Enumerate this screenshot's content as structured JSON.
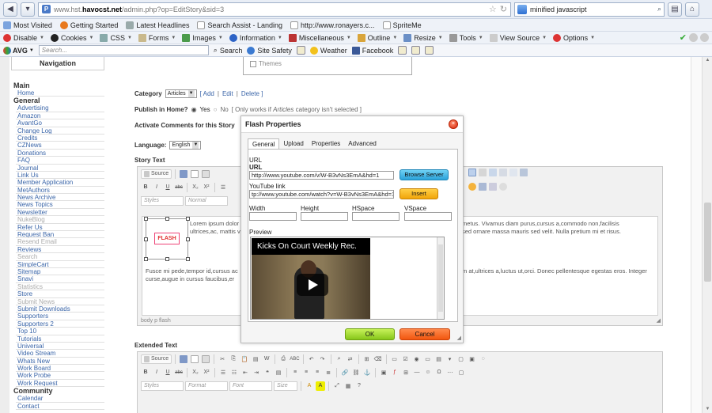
{
  "browser": {
    "url_prefix": "www.hst.",
    "url_domain": "havocst.net",
    "url_path": "/admin.php?op=EditStory&sid=3",
    "search_value": "minified javascript",
    "bookmarks": [
      "Most Visited",
      "Getting Started",
      "Latest Headlines",
      "Search Assist - Landing",
      "http://www.ronayers.c...",
      "SpriteMe"
    ],
    "webdev_toolbar": [
      "Disable",
      "Cookies",
      "CSS",
      "Forms",
      "Images",
      "Information",
      "Miscellaneous",
      "Outline",
      "Resize",
      "Tools",
      "View Source",
      "Options"
    ],
    "avg": {
      "logo": "AVG",
      "search_placeholder": "Search...",
      "search_button": "Search",
      "site_safety": "Site Safety",
      "weather": "Weather",
      "facebook": "Facebook"
    }
  },
  "sidebar": {
    "title": "Navigation",
    "main_heading": "Main",
    "main_items": [
      "Home"
    ],
    "general_heading": "General",
    "general_items": [
      "Advertising",
      "Amazon",
      "AvantGo",
      "Change Log",
      "Credits",
      "CZNews",
      "Donations",
      "FAQ",
      "Journal",
      "Link Us",
      "Member Application",
      "MetAuthors",
      "News Archive",
      "News Topics",
      "Newsletter",
      "NukeBlog",
      "Refer Us",
      "Request Ban",
      "Resend Email",
      "Reviews",
      "Search",
      "SimpleCart",
      "Sitemap",
      "Snavi",
      "Statistics",
      "Store",
      "Submit News",
      "Submit Downloads",
      "Supporters",
      "Supporters 2",
      "Top 10",
      "Tutorials",
      "Universal",
      "Video Stream",
      "Whats New",
      "Work Board",
      "Work Probe",
      "Work Request"
    ],
    "general_disabled": [
      "NukeBlog",
      "Resend Email",
      "Search",
      "Statistics",
      "Submit News"
    ],
    "community_heading": "Community",
    "community_items": [
      "Calendar",
      "Contact"
    ]
  },
  "form": {
    "themes_label": "Themes",
    "category_label": "Category",
    "category_value": "Articles",
    "category_add": "[ Add",
    "category_edit": "Edit",
    "category_delete": "Delete ]",
    "sep": "|",
    "publish_label": "Publish in Home?",
    "publish_yes": "Yes",
    "publish_no": "No",
    "publish_note_pre": "[ Only works if",
    "publish_note_em": "Articles",
    "publish_note_post": "category isn't selected ]",
    "comments_label": "Activate Comments for this Story",
    "language_label": "Language:",
    "language_value": "English",
    "story_text_label": "Story Text",
    "extended_text_label": "Extended Text"
  },
  "editor": {
    "source_label": "Source",
    "styles_combo": "Styles",
    "format_combo": "Normal",
    "format_combo2": "Format",
    "font_combo": "Font",
    "size_combo": "Size",
    "flash_tag": "FLASH",
    "body_p1a": "Lorem ipsum dolor s",
    "body_p1b": "ultrices,ac, mattis vitae,nulla. Aenean d",
    "body_p1c": "metus. Vivamus diam purus,cursus a,commodo non,facilisis",
    "body_p1d": "sed ornare massa mauris sed velit. Nulla pretium mi et risus.",
    "body_p2a": "Fusce mi pede,tempor id,cursus ac",
    "body_p2b": "curse,augue in cursus faucibus,er",
    "body_p2c": "m at,ultrices a,luctus ut,orci. Donec pellentesque egestas eros. Integer",
    "footer_path": "body   p   flash"
  },
  "dialog": {
    "title": "Flash Properties",
    "tabs": [
      "General",
      "Upload",
      "Properties",
      "Advanced"
    ],
    "url_label_1": "URL",
    "url_label_2": "URL",
    "url_value": "http://www.youtube.com/v/W-B3vNs3EmA&hd=1",
    "browse_button": "Browse Server",
    "youtube_label": "YouTube link",
    "youtube_value": "tp://www.youtube.com/watch?v=W-B3vNs3EmA&hd=1",
    "insert_button": "Insert",
    "width_label": "Width",
    "height_label": "Height",
    "hspace_label": "HSpace",
    "vspace_label": "VSpace",
    "preview_label": "Preview",
    "video_title": "Kicks On Court Weekly Rec.",
    "ok_button": "OK",
    "cancel_button": "Cancel"
  }
}
